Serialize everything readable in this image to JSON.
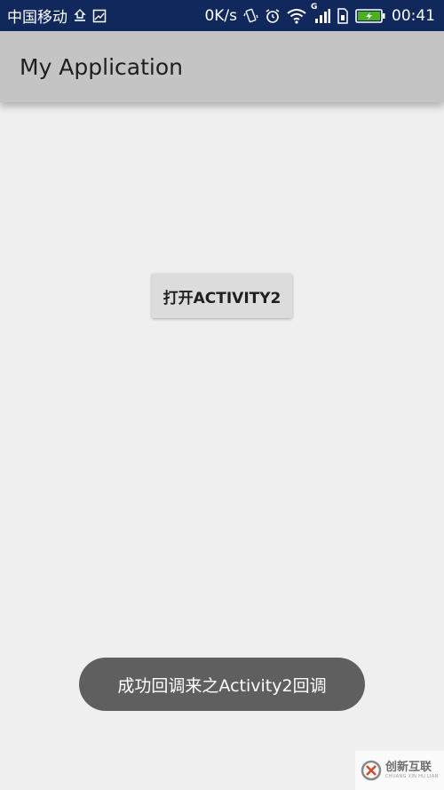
{
  "status_bar": {
    "carrier": "中国移动",
    "net_speed": "0K/s",
    "network_type": "G",
    "time": "00:41",
    "icons": [
      "usb-icon",
      "image-icon",
      "vibrate-icon",
      "alarm-icon",
      "wifi-icon",
      "signal-icon",
      "sim-icon",
      "battery-charging-icon"
    ],
    "battery_color": "#4caf1e"
  },
  "app_bar": {
    "title": "My Application"
  },
  "main": {
    "open_button_label": "打开ACTIVITY2"
  },
  "toast": {
    "message": "成功回调来之Activity2回调"
  },
  "watermark": {
    "name": "创新互联",
    "subtitle": "CHUANG XIN HU LIAN"
  },
  "colors": {
    "status_bar_bg": "#10285c",
    "app_bar_bg": "#c4c4c4",
    "background": "#efefef",
    "toast_bg": "#5f5f5f"
  }
}
